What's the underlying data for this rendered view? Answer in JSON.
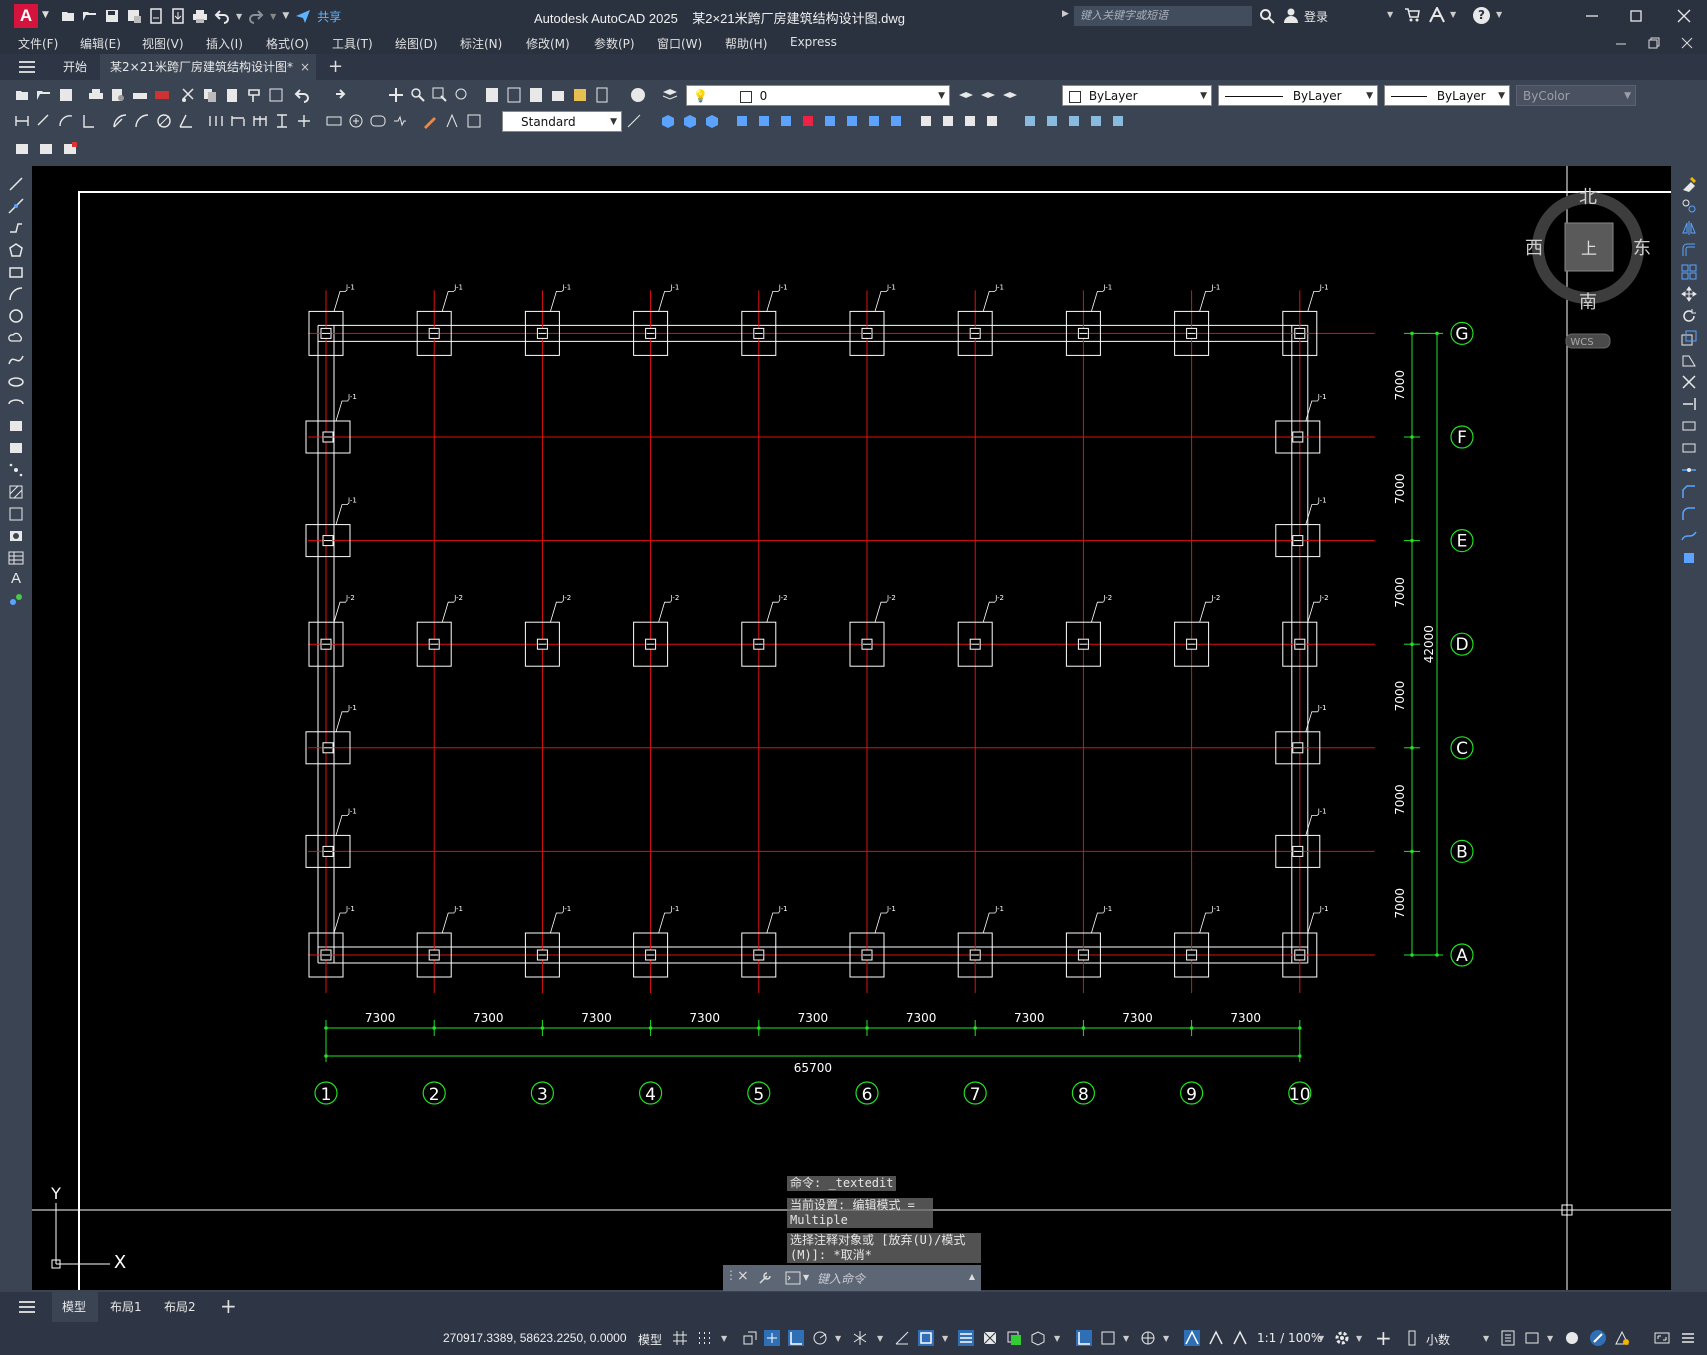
{
  "app": {
    "title": "Autodesk AutoCAD 2025",
    "file": "某2×21米跨厂房建筑结构设计图.dwg",
    "logo": "A",
    "search_placeholder": "键入关键字或短语",
    "share_label": "共享",
    "login_label": "登录",
    "help_icon": "?"
  },
  "menu": [
    "文件(F)",
    "编辑(E)",
    "视图(V)",
    "插入(I)",
    "格式(O)",
    "工具(T)",
    "绘图(D)",
    "标注(N)",
    "修改(M)",
    "参数(P)",
    "窗口(W)",
    "帮助(H)",
    "Express"
  ],
  "tabs": {
    "start": "开始",
    "drawing": "某2×21米跨厂房建筑结构设计图*"
  },
  "toolbar": {
    "layer_value": "0",
    "color_value": "ByLayer",
    "linetype_value": "ByLayer",
    "lineweight_value": "ByLayer",
    "plotstyle_value": "ByColor",
    "textstyle_value": "Standard"
  },
  "viewcube": {
    "north": "北",
    "south": "南",
    "east": "东",
    "west": "西",
    "top": "上",
    "wcs": "WCS"
  },
  "drawing": {
    "column_axes": [
      "1",
      "2",
      "3",
      "4",
      "5",
      "6",
      "7",
      "8",
      "9",
      "10"
    ],
    "row_axes": [
      "A",
      "B",
      "C",
      "D",
      "E",
      "F",
      "G"
    ],
    "column_spacing_label": "7300",
    "row_spacing_label": "7000",
    "total_width_label": "65700",
    "total_height_label": "42000",
    "footing_j1": "J-1",
    "footing_j2": "J-2",
    "ucs_x": "X",
    "ucs_y": "Y"
  },
  "command": {
    "history": [
      "命令: _textedit",
      "当前设置: 编辑模式 = Multiple",
      "选择注释对象或 [放弃(U)/模式(M)]: *取消*"
    ],
    "input_placeholder": "键入命令"
  },
  "layout_tabs": [
    "模型",
    "布局1",
    "布局2"
  ],
  "status": {
    "coordinates": "270917.3389, 58623.2250, 0.0000",
    "space": "模型",
    "scale": "1:1 / 100%",
    "units": "小数"
  }
}
